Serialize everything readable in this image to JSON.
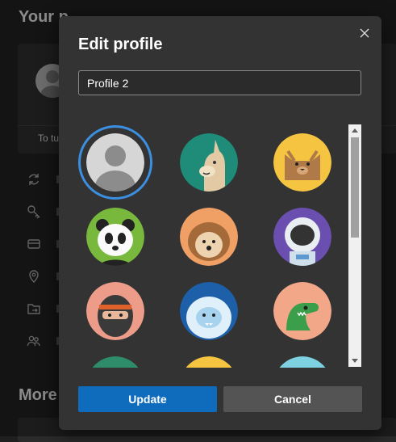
{
  "background": {
    "title": "Your p",
    "turn_text": "To tu",
    "more_title": "More",
    "icons": [
      "sync-icon",
      "key-icon",
      "card-icon",
      "location-icon",
      "folder-icon",
      "people-icon"
    ]
  },
  "dialog": {
    "title": "Edit profile",
    "close_icon": "close-icon",
    "name_value": "Profile 2",
    "avatars": [
      {
        "name": "default-avatar",
        "selected": true
      },
      {
        "name": "llama-avatar",
        "selected": false
      },
      {
        "name": "cat-avatar",
        "selected": false
      },
      {
        "name": "panda-avatar",
        "selected": false
      },
      {
        "name": "hedgehog-avatar",
        "selected": false
      },
      {
        "name": "astronaut-avatar",
        "selected": false
      },
      {
        "name": "ninja-avatar",
        "selected": false
      },
      {
        "name": "yeti-avatar",
        "selected": false
      },
      {
        "name": "dinosaur-avatar",
        "selected": false
      }
    ],
    "update_label": "Update",
    "cancel_label": "Cancel"
  },
  "colors": {
    "accent": "#0f6cbd",
    "selection_ring": "#3c8ee0",
    "dialog_bg": "#333333"
  }
}
